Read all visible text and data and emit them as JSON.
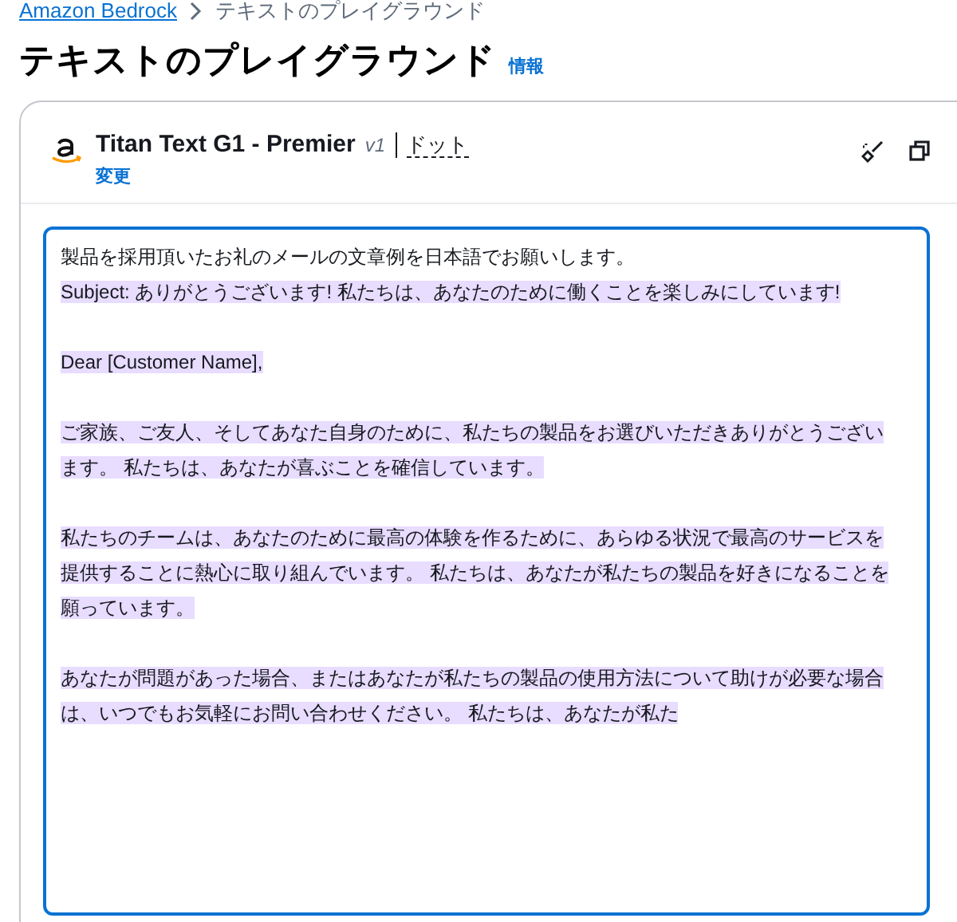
{
  "breadcrumb": {
    "link": "Amazon Bedrock",
    "current": "テキストのプレイグラウンド"
  },
  "page": {
    "title": "テキストのプレイグラウンド",
    "info_link": "情報"
  },
  "model": {
    "name": "Titan Text G1 - Premier",
    "version": "v1",
    "mode": "ドット",
    "change_link": "変更"
  },
  "editor": {
    "focused": true,
    "prompt": "製品を採用頂いたお礼のメールの文章例を日本語でお願いします。",
    "response": {
      "highlighted": true,
      "paragraphs": [
        {
          "lines": [
            "Subject: ありがとうございます! 私たちは、あなたのために働くことを楽しみにしています!"
          ]
        },
        {
          "lines": [
            "Dear [Customer Name],"
          ]
        },
        {
          "lines": [
            "ご家族、ご友人、そしてあなた自身のために、私たちの製品をお選びいただきありがとうござい",
            "ます。 私たちは、あなたが喜ぶことを確信しています。"
          ]
        },
        {
          "lines": [
            "私たちのチームは、あなたのために最高の体験を作るために、あらゆる状況で最高のサービスを",
            "提供することに熱心に取り組んでいます。 私たちは、あなたが私たちの製品を好きになることを",
            "願っています。"
          ]
        },
        {
          "lines": [
            "あなたが問題があった場合、またはあなたが私たちの製品の使用方法について助けが必要な場合",
            "は、いつでもお気軽にお問い合わせください。 私たちは、あなたが私た"
          ]
        }
      ]
    }
  }
}
